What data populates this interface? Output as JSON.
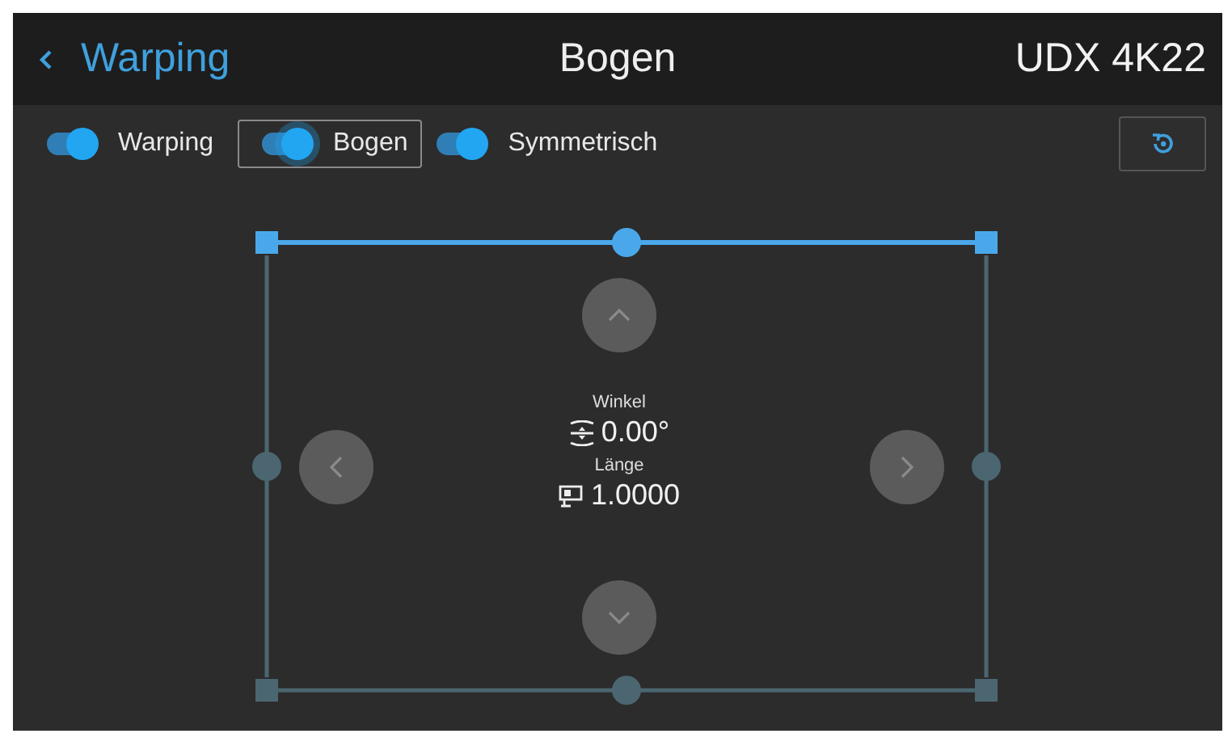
{
  "header": {
    "back_label": "Warping",
    "title": "Bogen",
    "device": "UDX 4K22"
  },
  "toggles": [
    {
      "label": "Warping",
      "on": true,
      "selected": false
    },
    {
      "label": "Bogen",
      "on": true,
      "selected": true
    },
    {
      "label": "Symmetrisch",
      "on": true,
      "selected": false
    }
  ],
  "edges": [
    {
      "kind": "top",
      "selected": true
    },
    {
      "kind": "right",
      "selected": false
    },
    {
      "kind": "bottom",
      "selected": false
    },
    {
      "kind": "left",
      "selected": false
    }
  ],
  "readouts": [
    {
      "kind": "angle",
      "label": "Winkel",
      "value": "0.00°"
    },
    {
      "kind": "length",
      "label": "Länge",
      "value": "1.0000"
    }
  ]
}
